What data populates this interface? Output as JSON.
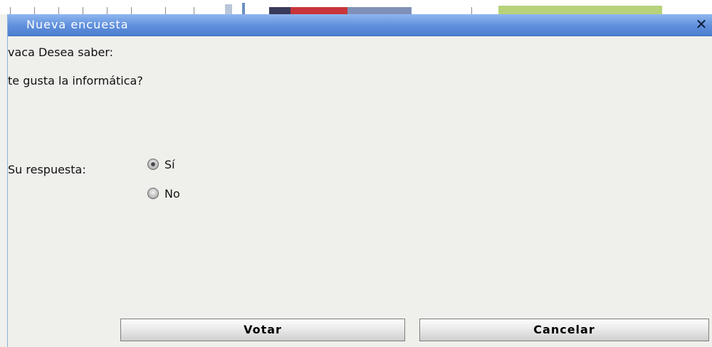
{
  "dialog": {
    "title": "Nueva encuesta",
    "close_icon": "close-icon"
  },
  "poll": {
    "line1": "vaca Desea saber:",
    "question": "te gusta la informática?",
    "answer_label": "Su respuesta:",
    "options": [
      {
        "label": "Sí",
        "checked": true
      },
      {
        "label": "No",
        "checked": false
      }
    ]
  },
  "buttons": {
    "vote": "Votar",
    "cancel": "Cancelar"
  },
  "colors": {
    "titlebar": "#5f8fdc",
    "dialog_bg": "#eff0ec"
  }
}
